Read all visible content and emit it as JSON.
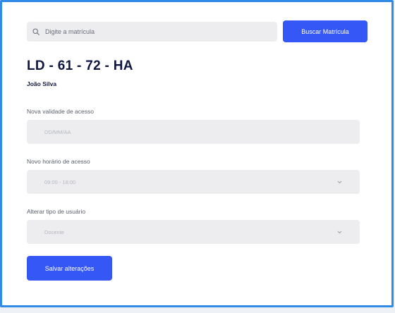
{
  "search": {
    "placeholder": "Digite a matrícula",
    "button_label": "Buscar Matrícula"
  },
  "record": {
    "plate": "LD - 61 - 72 - HA",
    "owner": "João Silva"
  },
  "form": {
    "validity": {
      "label": "Nova validade de acesso",
      "value": "DD/MM/AA"
    },
    "schedule": {
      "label": "Novo horário de acesso",
      "value": "09:00 - 18:00"
    },
    "user_type": {
      "label": "Alterar tipo de usuário",
      "value": "Docente"
    },
    "save_label": "Salvar alterações"
  },
  "colors": {
    "accent": "#3557f5",
    "frame_border": "#2f8ae8",
    "title": "#0f1640",
    "field_bg": "#ededf0"
  },
  "icons": {
    "search": "search-icon",
    "dropdown": "chevron-down-icon"
  }
}
